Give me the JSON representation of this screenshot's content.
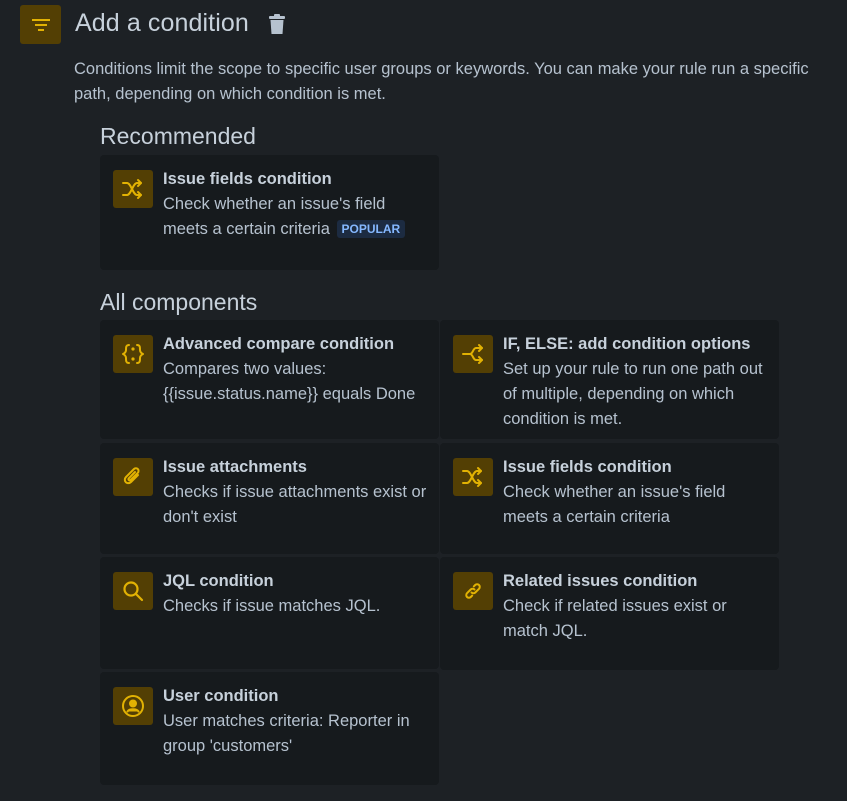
{
  "header": {
    "title": "Add a condition",
    "description": "Conditions limit the scope to specific user groups or keywords. You can make your rule run a specific path, depending on which condition is met."
  },
  "recommended": {
    "heading": "Recommended",
    "items": [
      {
        "title": "Issue fields condition",
        "desc": "Check whether an issue's field meets a certain criteria",
        "badge": "POPULAR",
        "icon": "shuffle-icon"
      }
    ]
  },
  "all": {
    "heading": "All components",
    "items": [
      {
        "title": "Advanced compare condition",
        "desc": "Compares two values: {{issue.status.name}} equals Done",
        "icon": "braces-icon"
      },
      {
        "title": "IF, ELSE: add condition options",
        "desc": "Set up your rule to run one path out of multiple, depending on which condition is met.",
        "icon": "branch-icon"
      },
      {
        "title": "Issue attachments",
        "desc": "Checks if issue attachments exist or don't exist",
        "icon": "paperclip-icon"
      },
      {
        "title": "Issue fields condition",
        "desc": "Check whether an issue's field meets a certain criteria",
        "icon": "shuffle-icon"
      },
      {
        "title": "JQL condition",
        "desc": "Checks if issue matches JQL.",
        "icon": "search-icon"
      },
      {
        "title": "Related issues condition",
        "desc": "Check if related issues exist or match JQL.",
        "icon": "link-icon"
      },
      {
        "title": "User condition",
        "desc": "User matches criteria: Reporter in group 'customers'",
        "icon": "user-icon"
      }
    ]
  },
  "colors": {
    "background": "#1d2125",
    "card": "#161a1d",
    "icon_bg": "#533f04",
    "icon_fg": "#e2b203",
    "badge_bg": "#1c2b41",
    "badge_fg": "#85b8ff"
  }
}
